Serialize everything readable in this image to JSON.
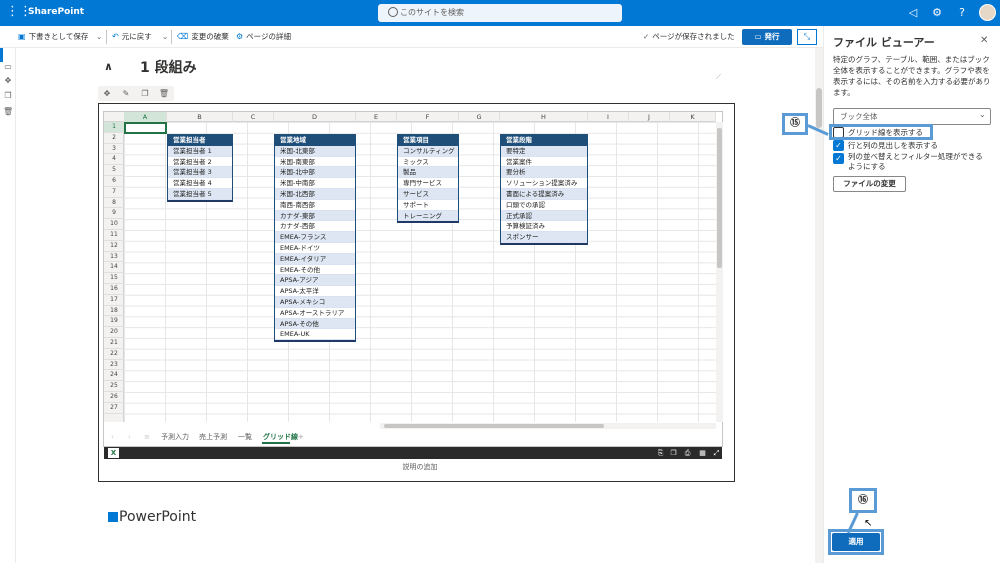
{
  "suite": {
    "app_name": "SharePoint",
    "search_placeholder": "このサイトを検索"
  },
  "command_bar": {
    "save_draft": "下書きとして保存",
    "undo": "元に戻す",
    "discard": "変更の破棄",
    "page_details": "ページの詳細",
    "saved_status": "ページが保存されました",
    "publish": "発行"
  },
  "section": {
    "title": "1 段組み"
  },
  "sheet": {
    "columns": [
      "A",
      "B",
      "C",
      "D",
      "E",
      "F",
      "G",
      "H",
      "I",
      "J",
      "K"
    ],
    "rows": [
      "1",
      "2",
      "3",
      "4",
      "5",
      "6",
      "7",
      "8",
      "9",
      "10",
      "11",
      "12",
      "13",
      "14",
      "15",
      "16",
      "17",
      "18",
      "19",
      "20",
      "21",
      "22",
      "23",
      "24",
      "25",
      "26",
      "27"
    ],
    "tables": {
      "sales_rep": {
        "header": "営業担当者",
        "items": [
          "営業担当者 1",
          "営業担当者 2",
          "営業担当者 3",
          "営業担当者 4",
          "営業担当者 5"
        ]
      },
      "sales_region": {
        "header": "営業地域",
        "items": [
          "米国-北東部",
          "米国-南東部",
          "米国-北中部",
          "米国-中南部",
          "米国-北西部",
          "南西-南西部",
          "カナダ-東部",
          "カナダ-西部",
          "EMEA-フランス",
          "EMEA-ドイツ",
          "EMEA-イタリア",
          "EMEA-その他",
          "APSA-アジア",
          "APSA-太平洋",
          "APSA-メキシコ",
          "APSA-オーストラリア",
          "APSA-その他",
          "EMEA-UK"
        ]
      },
      "sales_item": {
        "header": "営業項目",
        "items": [
          "コンサルティング",
          "ミックス",
          "製品",
          "専門サービス",
          "サービス",
          "サポート",
          "トレーニング"
        ]
      },
      "sales_stage": {
        "header": "営業段階",
        "items": [
          "要特定",
          "営業案件",
          "要分析",
          "ソリューション提案済み",
          "書面による提案済み",
          "口頭での承認",
          "正式承認",
          "予算検証済み",
          "スポンサー"
        ]
      }
    },
    "tabs": [
      "予測入力",
      "売上予測",
      "一覧",
      "グリッド線"
    ],
    "active_tab": "グリッド線",
    "add_tab": "+"
  },
  "caption_placeholder": "説明の追加",
  "next_heading": "PowerPoint",
  "panel": {
    "title": "ファイル ビューアー",
    "description": "特定のグラフ、テーブル、範囲、またはブック全体を表示することができます。グラフや表を表示するには、その名前を入力する必要があります。",
    "dropdown_value": "ブック全体",
    "options": [
      {
        "label": "グリッド線を表示する",
        "checked": false
      },
      {
        "label": "行と列の見出しを表示する",
        "checked": true
      },
      {
        "label": "列の並べ替えとフィルター処理ができるようにする",
        "checked": true
      }
    ],
    "change_file": "ファイルの変更",
    "apply": "適用"
  },
  "callouts": {
    "step15": "⑮",
    "step16": "⑯"
  },
  "colors": {
    "brand": "#0078d4",
    "excel_green": "#217346",
    "table_header": "#1f4e79",
    "callout": "#5b9bd5"
  }
}
